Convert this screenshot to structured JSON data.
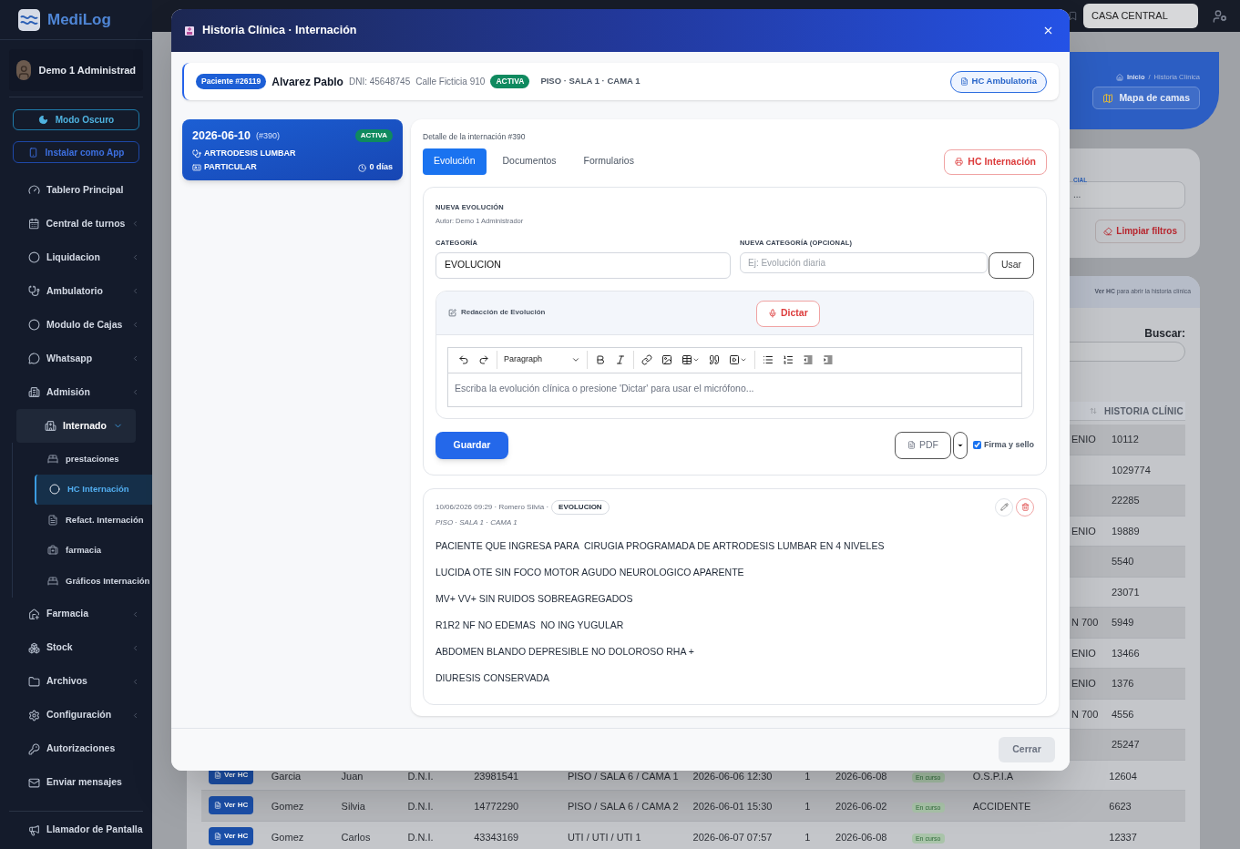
{
  "app": {
    "brand": "MediLog"
  },
  "sidebar": {
    "user": "Demo 1 Administrad",
    "buttons": [
      "Modo Oscuro",
      "Instalar como App"
    ],
    "items": [
      {
        "label": "Tablero Principal",
        "has_submenu": false,
        "expanded": false
      },
      {
        "label": "Central de turnos",
        "has_submenu": true,
        "expanded": false
      },
      {
        "label": "Liquidacion",
        "has_submenu": true,
        "expanded": false
      },
      {
        "label": "Ambulatorio",
        "has_submenu": true,
        "expanded": false
      },
      {
        "label": "Modulo de Cajas",
        "has_submenu": true,
        "expanded": false
      },
      {
        "label": "Whatsapp",
        "has_submenu": true,
        "expanded": false
      },
      {
        "label": "Admisión",
        "has_submenu": true,
        "expanded": false
      },
      {
        "label": "Internado",
        "has_submenu": true,
        "expanded": true,
        "children": [
          {
            "label": "prestaciones",
            "selected": false
          },
          {
            "label": "HC Internación",
            "selected": true
          },
          {
            "label": "Refact. Internación",
            "selected": false
          },
          {
            "label": "farmacia",
            "selected": false
          },
          {
            "label": "Gráficos Internación",
            "selected": false
          }
        ]
      },
      {
        "label": "Farmacia",
        "has_submenu": true,
        "expanded": false
      },
      {
        "label": "Stock",
        "has_submenu": true,
        "expanded": false
      },
      {
        "label": "Archivos",
        "has_submenu": true,
        "expanded": false
      },
      {
        "label": "Configuración",
        "has_submenu": true,
        "expanded": false
      },
      {
        "label": "Autorizaciones",
        "has_submenu": false,
        "expanded": false
      },
      {
        "label": "Enviar mensajes",
        "has_submenu": false,
        "expanded": false
      }
    ],
    "footer_item": "Llamador de Pantalla"
  },
  "topbar": {
    "branch": "CASA CENTRAL"
  },
  "page": {
    "breadcrumb": {
      "items": [
        "Inicio",
        "Historia Clínica"
      ],
      "separator": "/"
    },
    "map_button": "Mapa de camas",
    "filters": {
      "field_label": "CIAL",
      "field_value": "...",
      "clear_button": "Limpiar filtros"
    },
    "table": {
      "hint": "**Ver HC** para abrir la historia clínica",
      "search_label": "Buscar:",
      "columns": [
        "HISTORIA CLÍNIC"
      ],
      "rows": [
        {
          "kind": "covered",
          "fragment": "ENIO",
          "hc": "10112"
        },
        {
          "kind": "covered",
          "hc": "1029774"
        },
        {
          "kind": "covered",
          "hc": "22285"
        },
        {
          "kind": "covered",
          "fragment": "ENIO",
          "hc": "19889"
        },
        {
          "kind": "covered",
          "hc": "5540"
        },
        {
          "kind": "covered",
          "hc": "23071"
        },
        {
          "kind": "covered",
          "fragment": "N 700",
          "hc": "5949"
        },
        {
          "kind": "covered",
          "fragment": "ENIO",
          "hc": "13466"
        },
        {
          "kind": "covered",
          "fragment": "ENIO",
          "hc": "1376"
        },
        {
          "kind": "covered",
          "fragment": "N 700",
          "hc": "4556"
        },
        {
          "kind": "covered",
          "hc": "25247"
        },
        {
          "kind": "full",
          "button": "Ver HC",
          "cells": [
            "Garcia",
            "Juan",
            "D.N.I.",
            "23981541",
            "PISO / SALA 6 / CAMA 1",
            "2026-06-06 12:30",
            "1",
            "2026-06-08"
          ],
          "status": "En curso",
          "insurance": "O.S.P.I.A",
          "hc": "12604"
        },
        {
          "kind": "full",
          "button": "Ver HC",
          "cells": [
            "Gomez",
            "Silvia",
            "D.N.I.",
            "14772290",
            "PISO / SALA 6 / CAMA 2",
            "2026-06-01 15:30",
            "1",
            "2026-06-02"
          ],
          "status": "En curso",
          "insurance": "ACCIDENTE",
          "hc": "6623"
        },
        {
          "kind": "full",
          "button": "Ver HC",
          "cells": [
            "Gomez",
            "Carlos",
            "D.N.I.",
            "43343169",
            "UTI / UTI / UTI 1",
            "2026-06-07 07:57",
            "1",
            "2026-06-08"
          ],
          "status": "En curso",
          "hc": "12337"
        }
      ]
    }
  },
  "modal": {
    "title": "Historia Clínica · Internación",
    "patient": {
      "badge": "Paciente #26119",
      "name": "Alvarez Pablo",
      "dni": "DNI: 45648745",
      "address": "Calle Ficticia 910",
      "status": "ACTIVA",
      "location": "PISO · SALA 1 · CAMA 1",
      "button": "HC Ambulatoria"
    },
    "admissions": [
      {
        "date": "2026-06-10",
        "ref": "(#390)",
        "status": "ACTIVA",
        "diagnosis": "ARTRODESIS LUMBAR",
        "coverage": "PARTICULAR",
        "days": "0 días"
      }
    ],
    "detail": {
      "title": "Detalle de la internación #390",
      "tabs": [
        {
          "label": "Evolución",
          "selected": true
        },
        {
          "label": "Documentos",
          "selected": false
        },
        {
          "label": "Formularios",
          "selected": false
        }
      ],
      "print_button": "HC Internación",
      "form": {
        "heading": "NUEVA EVOLUCIÓN",
        "author": "Autor: Demo 1 Administrador",
        "category_label": "CATEGORÍA",
        "category_value": "EVOLUCION",
        "new_category_label": "NUEVA CATEGORÍA (OPCIONAL)",
        "new_category_placeholder": "Ej: Evolución diaria",
        "use_button": "Usar",
        "editor_title": "Redacción de Evolución",
        "dictate_button": "Dictar",
        "block_format": "Paragraph",
        "editor_placeholder": "Escriba la evolución clínica o presione 'Dictar' para usar el micrófono...",
        "save_button": "Guardar",
        "pdf_button": "PDF",
        "sign": {
          "label": "Firma y sello",
          "checked": true
        }
      },
      "entries": [
        {
          "meta": "10/06/2026 09:29 · Romero Silvia ·",
          "category": "EVOLUCION",
          "location": "PISO · SALA 1 · CAMA 1",
          "lines": [
            "PACIENTE QUE INGRESA PARA  CIRUGIA PROGRAMADA DE ARTRODESIS LUMBAR EN 4 NIVELES",
            "LUCIDA OTE SIN FOCO MOTOR AGUDO NEUROLOGICO APARENTE",
            "MV+ VV+ SIN RUIDOS SOBREAGREGADOS",
            "R1R2 NF NO EDEMAS  NO ING YUGULAR",
            "ABDOMEN BLANDO DEPRESIBLE NO DOLOROSO RHA +",
            "DIURESIS CONSERVADA"
          ]
        }
      ]
    },
    "close_button": "Cerrar"
  }
}
